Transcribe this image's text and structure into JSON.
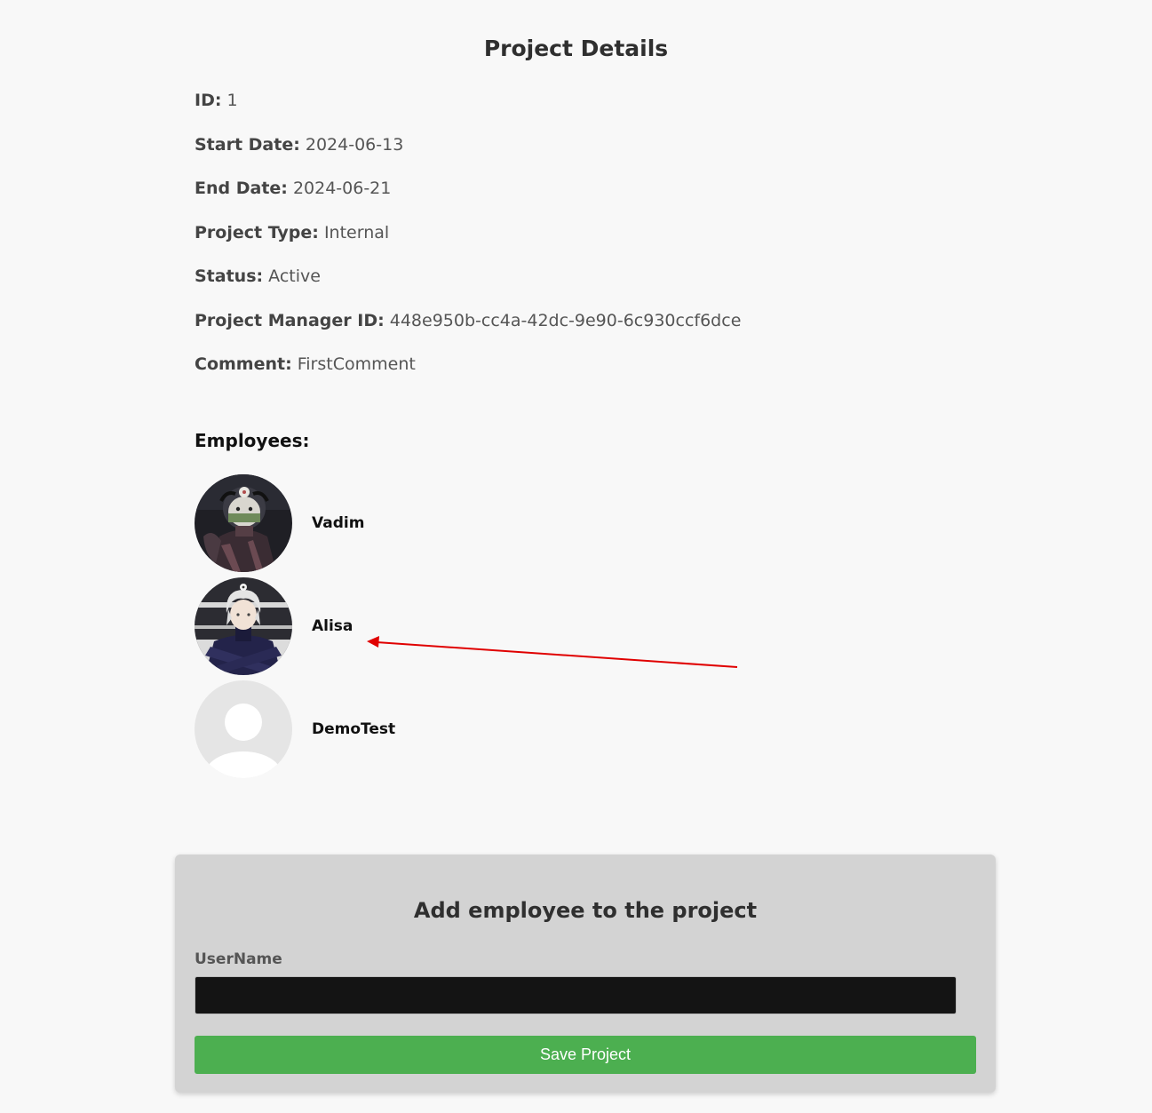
{
  "page": {
    "title": "Project Details"
  },
  "details": [
    {
      "label": "ID:",
      "value": "1"
    },
    {
      "label": "Start Date:",
      "value": "2024-06-13"
    },
    {
      "label": "End Date:",
      "value": "2024-06-21"
    },
    {
      "label": "Project Type:",
      "value": "Internal"
    },
    {
      "label": "Status:",
      "value": "Active"
    },
    {
      "label": "Project Manager ID:",
      "value": "448e950b-cc4a-42dc-9e90-6c930ccf6dce"
    },
    {
      "label": "Comment:",
      "value": "FirstComment"
    }
  ],
  "employees": {
    "heading": "Employees:",
    "items": [
      {
        "name": "Vadim",
        "avatar": "anime-character-avatar-dark"
      },
      {
        "name": "Alisa",
        "avatar": "anime-character-avatar-white-hair"
      },
      {
        "name": "DemoTest",
        "avatar": "default-user-placeholder-avatar"
      }
    ]
  },
  "annotation": {
    "arrow_color": "#e00000",
    "points_to": "Alisa"
  },
  "add_employee": {
    "title": "Add employee to the project",
    "username_label": "UserName",
    "username_value": "",
    "save_label": "Save Project"
  },
  "colors": {
    "background": "#f8f8f8",
    "panel": "#d3d3d3",
    "input": "#141414",
    "save_button": "#4caf50"
  }
}
